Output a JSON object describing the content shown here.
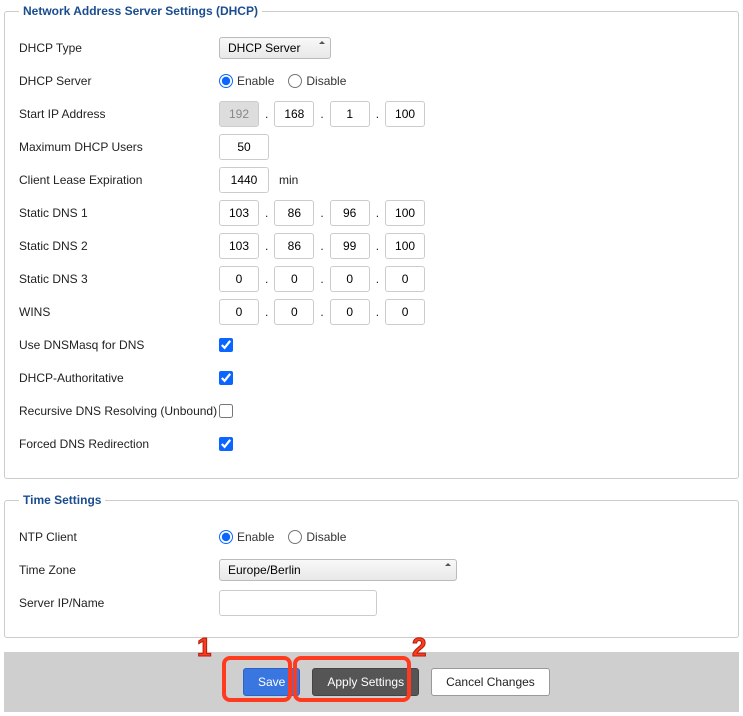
{
  "dhcp": {
    "legend": "Network Address Server Settings (DHCP)",
    "type_label": "DHCP Type",
    "type_value": "DHCP Server",
    "server_label": "DHCP Server",
    "enable": "Enable",
    "disable": "Disable",
    "start_ip_label": "Start IP Address",
    "start_ip": {
      "o1": "192",
      "o2": "168",
      "o3": "1",
      "o4": "100"
    },
    "max_users_label": "Maximum DHCP Users",
    "max_users": "50",
    "lease_label": "Client Lease Expiration",
    "lease_value": "1440",
    "lease_unit": "min",
    "dns1_label": "Static DNS 1",
    "dns1": {
      "o1": "103",
      "o2": "86",
      "o3": "96",
      "o4": "100"
    },
    "dns2_label": "Static DNS 2",
    "dns2": {
      "o1": "103",
      "o2": "86",
      "o3": "99",
      "o4": "100"
    },
    "dns3_label": "Static DNS 3",
    "dns3": {
      "o1": "0",
      "o2": "0",
      "o3": "0",
      "o4": "0"
    },
    "wins_label": "WINS",
    "wins": {
      "o1": "0",
      "o2": "0",
      "o3": "0",
      "o4": "0"
    },
    "dnsmasq_label": "Use DNSMasq for DNS",
    "authoritative_label": "DHCP-Authoritative",
    "unbound_label": "Recursive DNS Resolving (Unbound)",
    "forced_redir_label": "Forced DNS Redirection"
  },
  "time": {
    "legend": "Time Settings",
    "ntp_label": "NTP Client",
    "tz_label": "Time Zone",
    "tz_value": "Europe/Berlin",
    "server_label": "Server IP/Name",
    "server_value": ""
  },
  "buttons": {
    "save": "Save",
    "apply": "Apply Settings",
    "cancel": "Cancel Changes"
  },
  "annot": {
    "one": "1",
    "two": "2"
  }
}
